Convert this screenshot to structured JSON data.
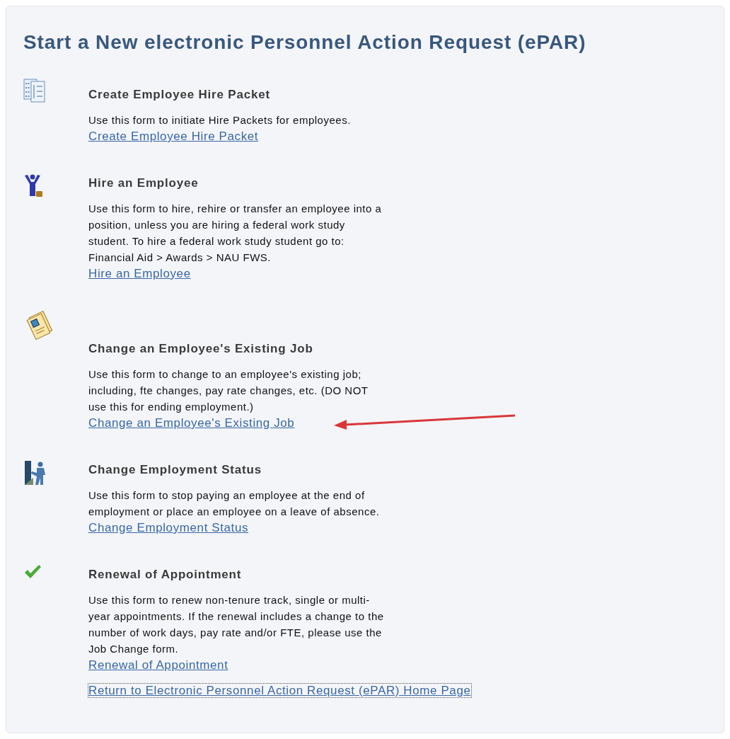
{
  "title": "Start a New electronic Personnel Action Request (ePAR)",
  "items": [
    {
      "kind": "list",
      "heading": "Create Employee Hire Packet",
      "description": "Use this form to initiate Hire Packets for employees.",
      "link": "Create Employee Hire Packet",
      "arrow": false
    },
    {
      "kind": "person",
      "heading": "Hire an Employee",
      "description": "Use this form to hire, rehire or transfer an employee into a position, unless you are hiring a federal work study student.  To hire a federal work study student go to: Financial Aid > Awards > NAU FWS.",
      "link": "Hire an Employee",
      "arrow": false
    },
    {
      "kind": "documents",
      "heading": "Change an Employee's Existing Job",
      "description": "Use this form to change to an employee's existing job; including, fte changes, pay rate changes, etc. (DO NOT use this for ending employment.)",
      "link": "Change an Employee's Existing Job",
      "arrow": true
    },
    {
      "kind": "door",
      "heading": "Change Employment Status",
      "description": "Use this form to stop paying an employee at the end of employment or place an employee on a leave of absence.",
      "link": "Change Employment Status",
      "arrow": false
    },
    {
      "kind": "check",
      "heading": "Renewal of Appointment",
      "description": "Use this form to renew non-tenure track, single or multi-year appointments.  If the renewal includes a change to the number of work days, pay rate and/or FTE, please use the Job Change form.",
      "link": "Renewal of Appointment",
      "arrow": false
    }
  ],
  "return_link": {
    "text": "Return to Electronic Personnel Action Request (ePAR) Home Page",
    "focused": true
  }
}
